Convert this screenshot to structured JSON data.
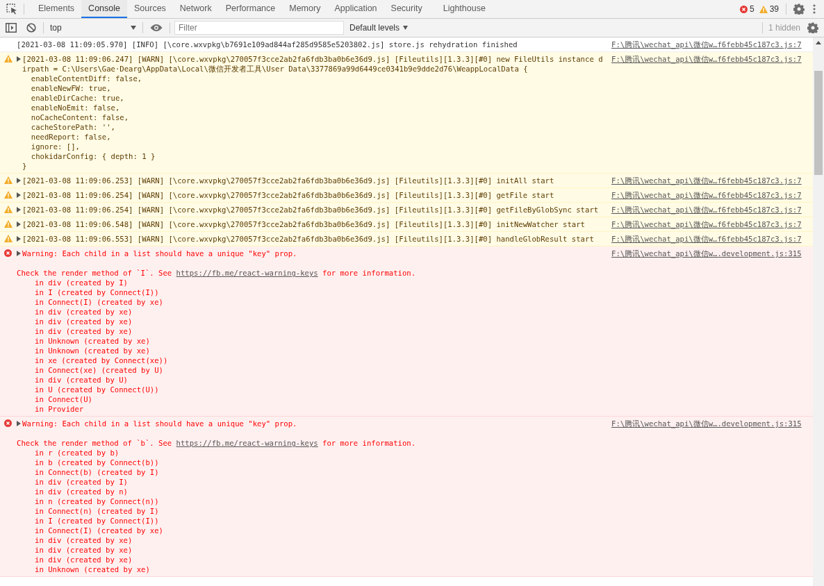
{
  "tabs": [
    {
      "label": "Elements",
      "selected": false
    },
    {
      "label": "Console",
      "selected": true
    },
    {
      "label": "Sources",
      "selected": false
    },
    {
      "label": "Network",
      "selected": false
    },
    {
      "label": "Performance",
      "selected": false
    },
    {
      "label": "Memory",
      "selected": false
    },
    {
      "label": "Application",
      "selected": false
    },
    {
      "label": "Security",
      "selected": false
    },
    {
      "label": "Lighthouse",
      "selected": false
    }
  ],
  "counts": {
    "errors": "5",
    "warnings": "39"
  },
  "toolbar": {
    "context": "top",
    "filter_placeholder": "Filter",
    "levels": "Default levels",
    "hidden": "1 hidden"
  },
  "messages": [
    {
      "kind": "info",
      "text": "[2021-03-08 11:09:05.970] [INFO] [\\core.wxvpkg\\b7691e109ad844af285d9585e5203802.js] store.js rehydration finished",
      "source": "F:\\腾讯\\wechat_api\\微信w…f6febb45c187c3.js:7"
    },
    {
      "kind": "warn",
      "text": "[2021-03-08 11:09:06.247] [WARN] [\\core.wxvpkg\\270057f3cce2ab2fa6fdb3ba0b6e36d9.js] [Fileutils][1.3.3][#0] new FileUtils instance dirpath = C:\\Users\\Gae·Dearg\\AppData\\Local\\微信开发者工具\\User Data\\3377869a99d6449ce0341b9e9dde2d76\\WeappLocalData {\n  enableContentDiff: false,\n  enableNewFW: true,\n  enableDirCache: true,\n  enableNoEmit: false,\n  noCacheContent: false,\n  cacheStorePath: '',\n  needReport: false,\n  ignore: [],\n  chokidarConfig: { depth: 1 }\n}",
      "source": "F:\\腾讯\\wechat_api\\微信w…f6febb45c187c3.js:7"
    },
    {
      "kind": "warn",
      "text": "[2021-03-08 11:09:06.253] [WARN] [\\core.wxvpkg\\270057f3cce2ab2fa6fdb3ba0b6e36d9.js] [Fileutils][1.3.3][#0] initAll start",
      "source": "F:\\腾讯\\wechat_api\\微信w…f6febb45c187c3.js:7"
    },
    {
      "kind": "warn",
      "text": "[2021-03-08 11:09:06.254] [WARN] [\\core.wxvpkg\\270057f3cce2ab2fa6fdb3ba0b6e36d9.js] [Fileutils][1.3.3][#0] getFile start",
      "source": "F:\\腾讯\\wechat_api\\微信w…f6febb45c187c3.js:7"
    },
    {
      "kind": "warn",
      "text": "[2021-03-08 11:09:06.254] [WARN] [\\core.wxvpkg\\270057f3cce2ab2fa6fdb3ba0b6e36d9.js] [Fileutils][1.3.3][#0] getFileByGlobSync start",
      "source": "F:\\腾讯\\wechat_api\\微信w…f6febb45c187c3.js:7"
    },
    {
      "kind": "warn",
      "text": "[2021-03-08 11:09:06.548] [WARN] [\\core.wxvpkg\\270057f3cce2ab2fa6fdb3ba0b6e36d9.js] [Fileutils][1.3.3][#0] initNewWatcher start",
      "source": "F:\\腾讯\\wechat_api\\微信w…f6febb45c187c3.js:7"
    },
    {
      "kind": "warn",
      "text": "[2021-03-08 11:09:06.553] [WARN] [\\core.wxvpkg\\270057f3cce2ab2fa6fdb3ba0b6e36d9.js] [Fileutils][1.3.3][#0] handleGlobResult start",
      "source": "F:\\腾讯\\wechat_api\\微信w…f6febb45c187c3.js:7"
    },
    {
      "kind": "error",
      "text": "Warning: Each child in a list should have a unique \"key\" prop.",
      "detail_before": "Check the render method of `I`. See ",
      "link": "https://fb.me/react-warning-keys",
      "detail_after": " for more information.",
      "stack": [
        "in div (created by I)",
        "in I (created by Connect(I))",
        "in Connect(I) (created by xe)",
        "in div (created by xe)",
        "in div (created by xe)",
        "in div (created by xe)",
        "in Unknown (created by xe)",
        "in Unknown (created by xe)",
        "in xe (created by Connect(xe))",
        "in Connect(xe) (created by U)",
        "in div (created by U)",
        "in U (created by Connect(U))",
        "in Connect(U)",
        "in Provider"
      ],
      "source": "F:\\腾讯\\wechat_api\\微信w….development.js:315"
    },
    {
      "kind": "error",
      "text": "Warning: Each child in a list should have a unique \"key\" prop.",
      "detail_before": "Check the render method of `b`. See ",
      "link": "https://fb.me/react-warning-keys",
      "detail_after": " for more information.",
      "stack": [
        "in r (created by b)",
        "in b (created by Connect(b))",
        "in Connect(b) (created by I)",
        "in div (created by I)",
        "in div (created by n)",
        "in n (created by Connect(n))",
        "in Connect(n) (created by I)",
        "in I (created by Connect(I))",
        "in Connect(I) (created by xe)",
        "in div (created by xe)",
        "in div (created by xe)",
        "in div (created by xe)",
        "in Unknown (created by xe)"
      ],
      "source": "F:\\腾讯\\wechat_api\\微信w….development.js:315"
    }
  ]
}
